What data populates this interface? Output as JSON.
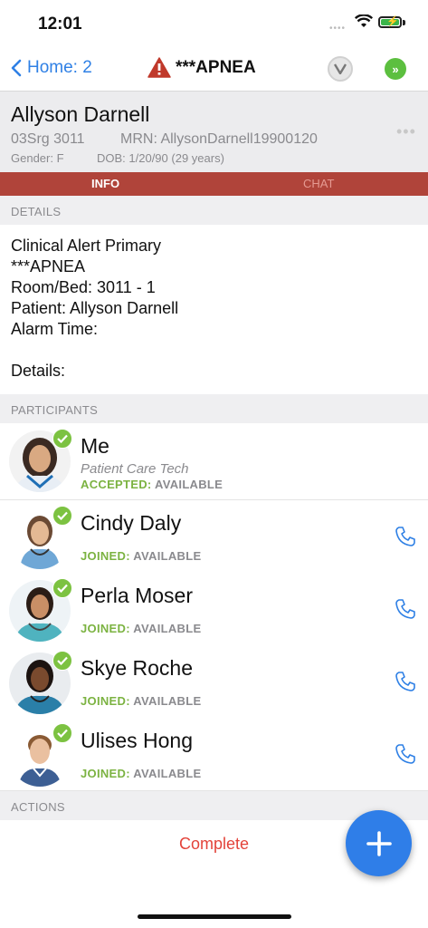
{
  "status": {
    "time": "12:01"
  },
  "nav": {
    "back_label": "Home: 2",
    "title": "***APNEA"
  },
  "patient": {
    "name": "Allyson Darnell",
    "unit": "03Srg 3011",
    "mrn": "MRN: AllysonDarnell19900120",
    "gender": "Gender: F",
    "dob": "DOB: 1/20/90 (29 years)"
  },
  "tabs": [
    {
      "label": "INFO"
    },
    {
      "label": "CHAT"
    }
  ],
  "sections": {
    "details": "DETAILS",
    "participants": "PARTICIPANTS",
    "actions": "ACTIONS"
  },
  "details": {
    "lines": [
      "Clinical Alert Primary",
      "***APNEA",
      "Room/Bed: 3011 - 1",
      "Patient: Allyson Darnell",
      "Alarm Time:",
      "",
      "Details:"
    ]
  },
  "participants": [
    {
      "name": "Me",
      "role": "Patient Care Tech",
      "state": "ACCEPTED:",
      "availability": "AVAILABLE"
    },
    {
      "name": "Cindy Daly",
      "role": "",
      "state": "JOINED:",
      "availability": "AVAILABLE"
    },
    {
      "name": "Perla Moser",
      "role": "",
      "state": "JOINED:",
      "availability": "AVAILABLE"
    },
    {
      "name": "Skye Roche",
      "role": "",
      "state": "JOINED:",
      "availability": "AVAILABLE"
    },
    {
      "name": "Ulises Hong",
      "role": "",
      "state": "JOINED:",
      "availability": "AVAILABLE"
    }
  ],
  "actions": {
    "complete_label": "Complete"
  },
  "colors": {
    "accent": "#2f80e5",
    "tab_bar": "#b0443a",
    "accepted_green": "#7cb342",
    "complete_red": "#e3433a"
  },
  "icons": [
    "back-chevron-icon",
    "warning-icon",
    "vocera-icon",
    "forward-icon",
    "check-icon",
    "phone-icon",
    "plus-icon",
    "more-icon"
  ]
}
